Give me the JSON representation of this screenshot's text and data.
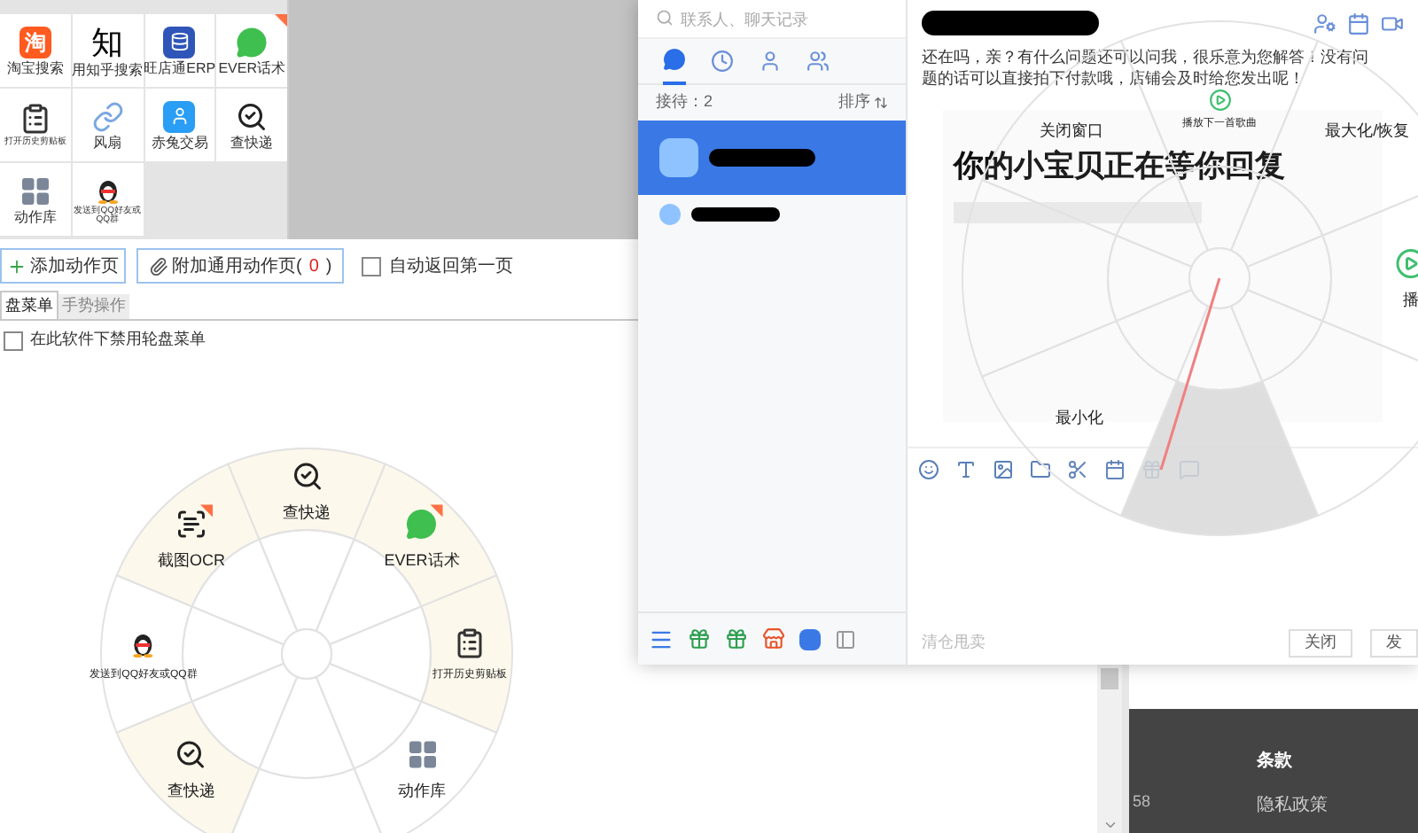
{
  "launcher": {
    "grid": [
      {
        "label": "淘宝搜索",
        "kind": "badge",
        "glyph": "淘",
        "flag": false
      },
      {
        "label": "用知乎搜索",
        "kind": "glyph",
        "glyph": "知",
        "flag": false
      },
      {
        "label": "旺店通ERP",
        "kind": "erp",
        "flag": false
      },
      {
        "label": "EVER话术",
        "kind": "chat",
        "flag": true
      },
      {
        "label": "打开历史剪贴板",
        "kind": "clipboard",
        "flag": false
      },
      {
        "label": "风扇",
        "kind": "link",
        "flag": false
      },
      {
        "label": "赤兔交易",
        "kind": "trade",
        "flag": false
      },
      {
        "label": "查快递",
        "kind": "search",
        "flag": false
      },
      {
        "label": "动作库",
        "kind": "grid",
        "flag": false
      },
      {
        "label": "发送到QQ好友或QQ群",
        "kind": "penguin",
        "flag": false
      }
    ]
  },
  "toolbar": {
    "add_button": "添加动作页",
    "attach_button": {
      "label": "附加通用动作页(",
      "count": "0",
      "suffix": ")"
    },
    "auto_return": {
      "label": "自动返回第一页",
      "checked": false
    }
  },
  "tabs": [
    {
      "label": "盘菜单",
      "selected": true
    },
    {
      "label": "手势操作",
      "selected": false
    }
  ],
  "disable_wheel": {
    "label": "在此软件下禁用轮盘菜单",
    "checked": false
  },
  "wheel": {
    "segments": [
      {
        "label": "查快递",
        "kind": "search",
        "highlighted": true,
        "flag": false
      },
      {
        "label": "截图OCR",
        "kind": "ocr",
        "highlighted": true,
        "flag": true
      },
      {
        "label": "EVER话术",
        "kind": "chat",
        "highlighted": true,
        "flag": true
      },
      {
        "label": "发送到QQ好友或QQ群",
        "kind": "penguin",
        "highlighted": false,
        "flag": false
      },
      {
        "label": "打开历史剪贴板",
        "kind": "clipboard",
        "highlighted": true,
        "flag": false
      },
      {
        "label": "查快递",
        "kind": "search",
        "highlighted": true,
        "flag": false
      },
      {
        "label": "动作库",
        "kind": "grid",
        "highlighted": false,
        "flag": false
      },
      {
        "highlighted": false
      }
    ]
  },
  "chat": {
    "search": {
      "placeholder": "联系人、聊天记录"
    },
    "nav_tabs": [
      {
        "selected": true
      },
      {
        "selected": false
      },
      {
        "selected": false
      },
      {
        "selected": false
      }
    ],
    "reception": "接待：2",
    "sort": "排序",
    "conversations": [
      {
        "selected": true
      },
      {
        "selected": false
      }
    ],
    "message": "还在吗，亲？有什么问题还可以问我，很乐意为您解答！没有问题的话可以直接拍下付款哦，店铺会及时给您发出呢！",
    "card_title": "你的小宝贝正在等你回复",
    "quick_phrase": "清仓甩卖",
    "buttons": [
      "关闭",
      "发"
    ]
  },
  "overlay_wheel": {
    "segments": [
      {
        "label": "播放下一首歌曲",
        "kind": "playnext",
        "selected": false
      },
      {
        "label": "关闭窗口",
        "kind": "text",
        "selected": false
      },
      {
        "label": "最大化/恢复",
        "kind": "text",
        "selected": false
      },
      {
        "selected": false
      },
      {
        "label": "播",
        "kind": "play",
        "selected": false
      },
      {
        "label": "最小化",
        "kind": "text",
        "selected": false
      },
      {
        "selected": false
      },
      {
        "selected": true
      }
    ]
  },
  "footer": {
    "side_text": "58",
    "heading": "条款",
    "links": [
      "隐私政策"
    ]
  }
}
